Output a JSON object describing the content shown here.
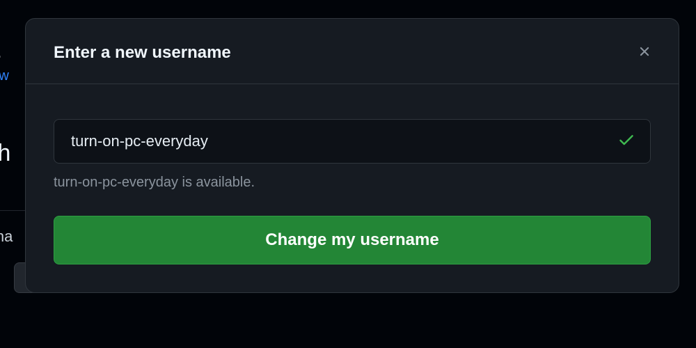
{
  "background": {
    "heading_fragment": "/a",
    "link_fragment": "Sw",
    "section_fragment": "Ch",
    "label_fragment": "Cha"
  },
  "modal": {
    "title": "Enter a new username",
    "username_input_value": "turn-on-pc-everyday",
    "status_message": "turn-on-pc-everyday is available.",
    "submit_label": "Change my username"
  }
}
